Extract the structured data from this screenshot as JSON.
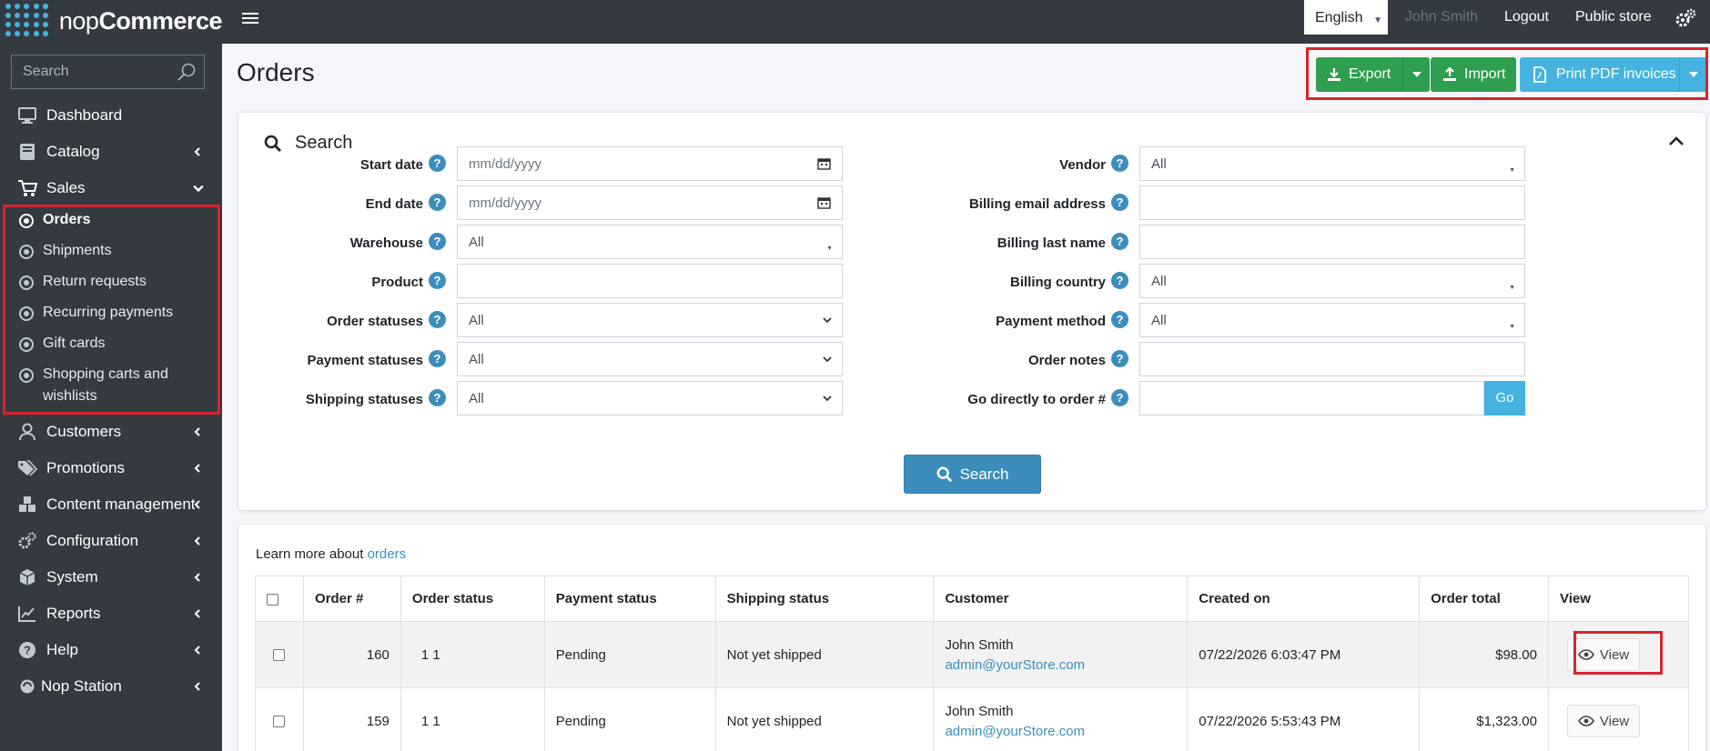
{
  "brand": {
    "name_light": "nop",
    "name_bold": "Commerce"
  },
  "topbar": {
    "language": "English",
    "user": "John Smith",
    "logout": "Logout",
    "public_store": "Public store"
  },
  "sidebar": {
    "search_placeholder": "Search",
    "items": [
      {
        "label": "Dashboard",
        "icon": "desktop-icon"
      },
      {
        "label": "Catalog",
        "icon": "book-icon"
      },
      {
        "label": "Sales",
        "icon": "cart-icon",
        "expanded": true
      },
      {
        "label": "Customers",
        "icon": "user-icon"
      },
      {
        "label": "Promotions",
        "icon": "tags-icon"
      },
      {
        "label": "Content management",
        "icon": "cubes-icon"
      },
      {
        "label": "Configuration",
        "icon": "cogs-icon"
      },
      {
        "label": "System",
        "icon": "cube-icon"
      },
      {
        "label": "Reports",
        "icon": "chart-icon"
      },
      {
        "label": "Help",
        "icon": "question-icon"
      },
      {
        "label": "Nop Station",
        "icon": "nopstation-icon"
      }
    ],
    "sales_sub": [
      {
        "label": "Orders",
        "active": true
      },
      {
        "label": "Shipments"
      },
      {
        "label": "Return requests"
      },
      {
        "label": "Recurring payments"
      },
      {
        "label": "Gift cards"
      },
      {
        "label": "Shopping carts and",
        "label2": "wishlists"
      }
    ]
  },
  "page": {
    "title": "Orders",
    "export": "Export",
    "import": "Import",
    "print_pdf": "Print PDF invoices"
  },
  "search": {
    "title": "Search",
    "left_fields": [
      {
        "label": "Start date",
        "value": "mm/dd/yyyy",
        "kind": "date"
      },
      {
        "label": "End date",
        "value": "mm/dd/yyyy",
        "kind": "date"
      },
      {
        "label": "Warehouse",
        "value": "All",
        "kind": "caret"
      },
      {
        "label": "Product",
        "value": "",
        "kind": "text"
      },
      {
        "label": "Order statuses",
        "value": "All",
        "kind": "select"
      },
      {
        "label": "Payment statuses",
        "value": "All",
        "kind": "select"
      },
      {
        "label": "Shipping statuses",
        "value": "All",
        "kind": "select"
      }
    ],
    "right_fields": [
      {
        "label": "Vendor",
        "value": "All",
        "kind": "caret"
      },
      {
        "label": "Billing email address",
        "value": "",
        "kind": "text"
      },
      {
        "label": "Billing last name",
        "value": "",
        "kind": "text"
      },
      {
        "label": "Billing country",
        "value": "All",
        "kind": "caret"
      },
      {
        "label": "Payment method",
        "value": "All",
        "kind": "caret"
      },
      {
        "label": "Order notes",
        "value": "",
        "kind": "text"
      },
      {
        "label": "Go directly to order #",
        "value": "",
        "kind": "go"
      }
    ],
    "go_label": "Go",
    "search_button": "Search",
    "help_glyph": "?"
  },
  "orders": {
    "learn_more_prefix": "Learn more about",
    "learn_more_link": "orders",
    "columns": [
      "Order #",
      "Order status",
      "Payment status",
      "Shipping status",
      "Customer",
      "Created on",
      "Order total",
      "View"
    ],
    "rows": [
      {
        "order": "160",
        "order_status": "1 1",
        "payment_status": "Pending",
        "shipping_status": "Not yet shipped",
        "customer_name": "John Smith",
        "customer_email": "admin@yourStore.com",
        "created_on": "07/22/2026 6:03:47 PM",
        "total": "$98.00",
        "view": "View"
      },
      {
        "order": "159",
        "order_status": "1 1",
        "payment_status": "Pending",
        "shipping_status": "Not yet shipped",
        "customer_name": "John Smith",
        "customer_email": "admin@yourStore.com",
        "created_on": "07/22/2026 5:53:43 PM",
        "total": "$1,323.00",
        "view": "View"
      }
    ]
  },
  "colors": {
    "accent_blue": "#3c8dbc",
    "green": "#2e9e4f",
    "light_blue": "#45b3e0",
    "sidebar": "#343a40",
    "highlight": "#d9232d"
  }
}
